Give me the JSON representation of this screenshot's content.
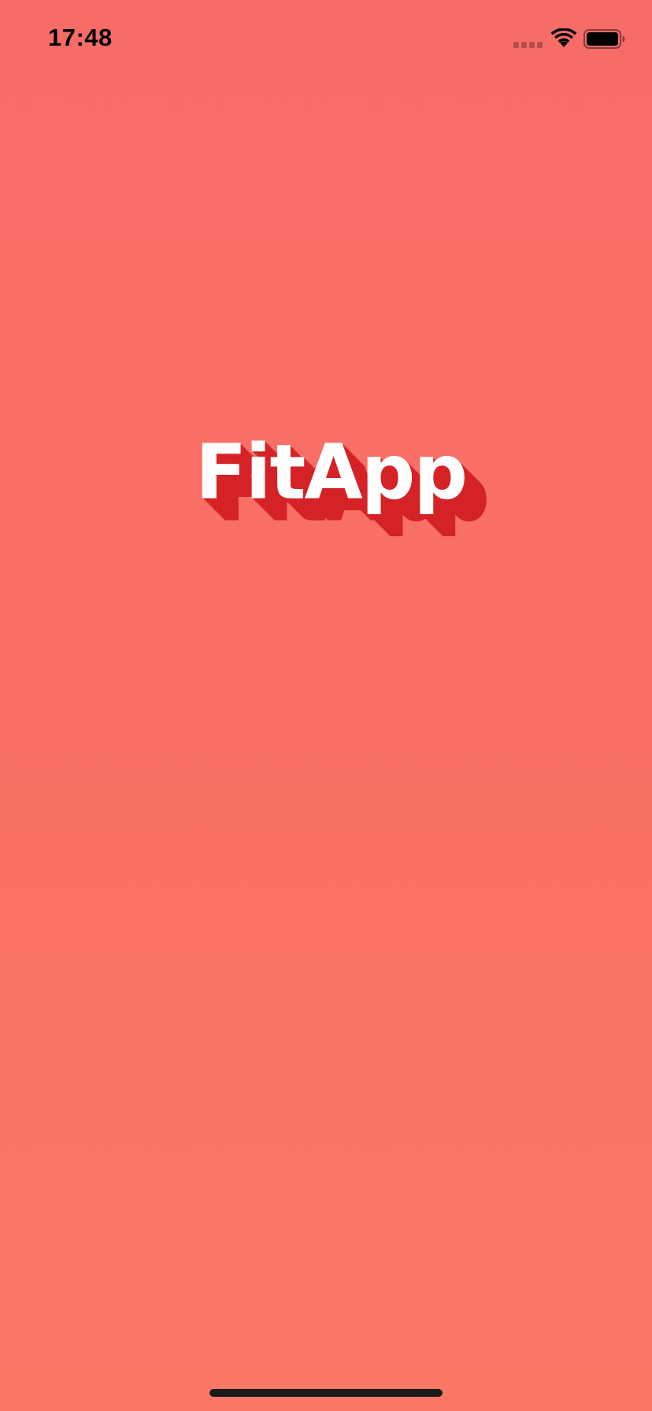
{
  "status_bar": {
    "time": "17:48",
    "icons": [
      "cellular-signal-icon",
      "wifi-icon",
      "battery-icon"
    ]
  },
  "splash": {
    "logo_text": "FitApp",
    "logo_color": "#ffffff",
    "logo_shadow_color": "#d42227"
  },
  "colors": {
    "background_top": "#f86c68",
    "background_bottom": "#fb7867",
    "home_indicator": "#1b1b1b"
  }
}
